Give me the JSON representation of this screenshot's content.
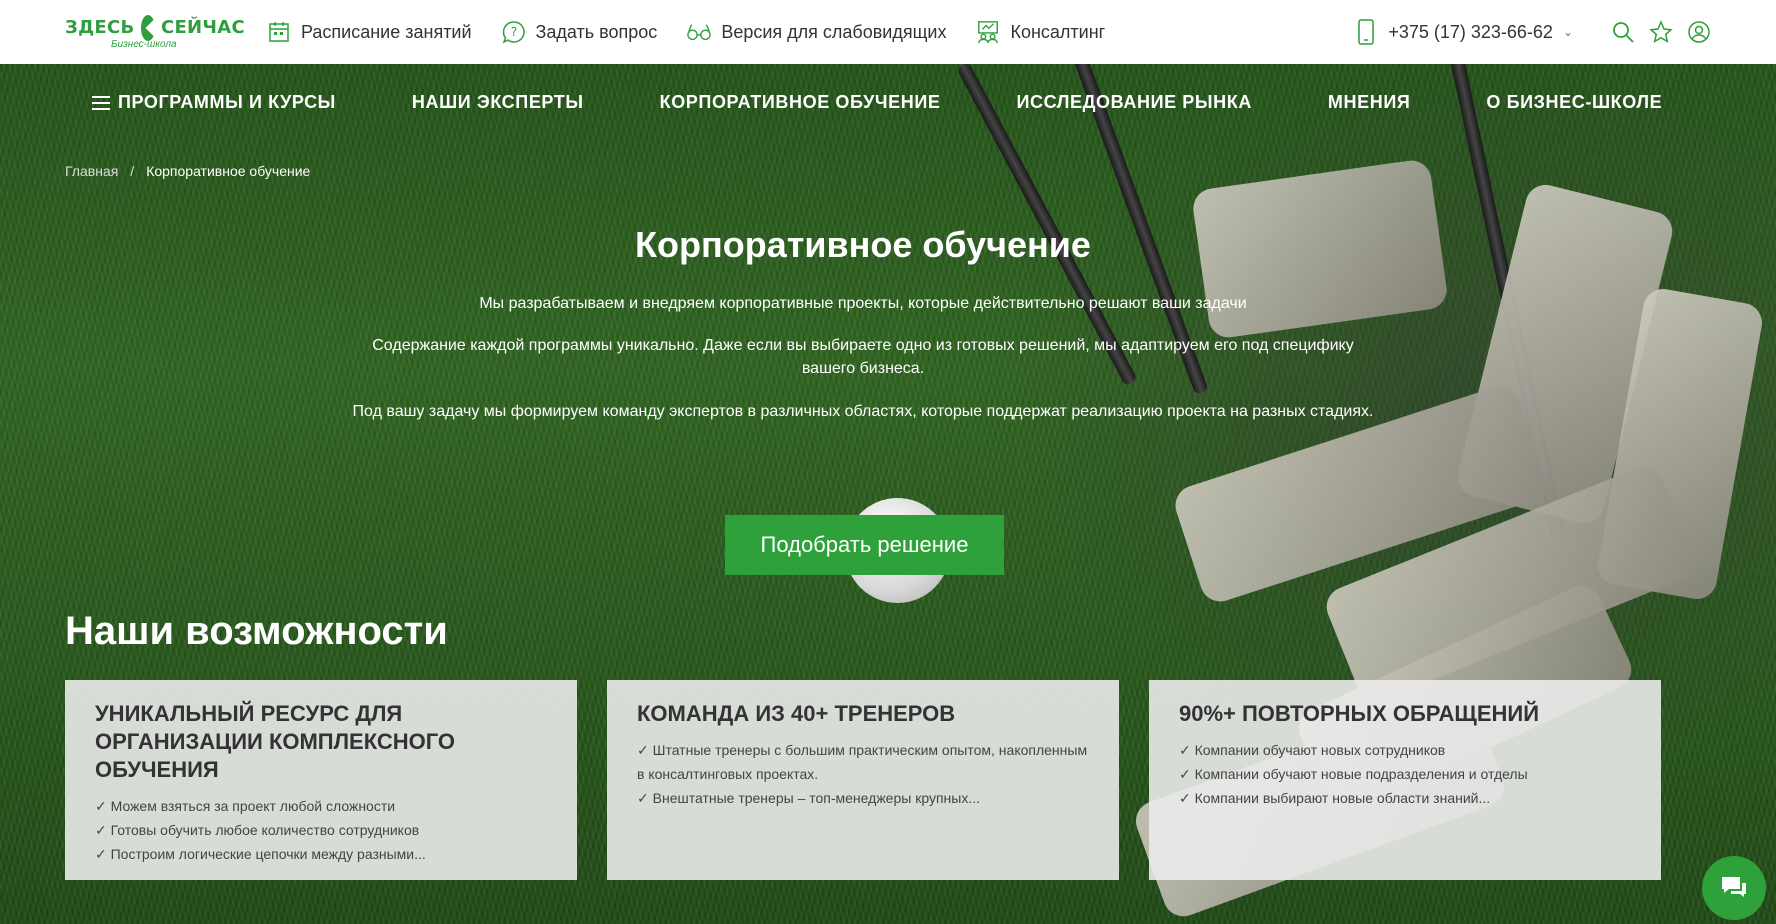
{
  "logo": {
    "name_left": "ЗДЕСЬ",
    "name_right": "СЕЙЧАС",
    "subtitle": "Бизнес-школа"
  },
  "top_links": [
    {
      "label": "Расписание занятий",
      "icon": "calendar-icon"
    },
    {
      "label": "Задать вопрос",
      "icon": "question-icon"
    },
    {
      "label": "Версия для слабовидящих",
      "icon": "glasses-icon"
    },
    {
      "label": "Консалтинг",
      "icon": "consulting-icon"
    }
  ],
  "phone": "+375 (17) 323-66-62",
  "main_nav": [
    "ПРОГРАММЫ И КУРСЫ",
    "НАШИ ЭКСПЕРТЫ",
    "КОРПОРАТИВНОЕ ОБУЧЕНИЕ",
    "ИССЛЕДОВАНИЕ РЫНКА",
    "МНЕНИЯ",
    "О БИЗНЕС-ШКОЛЕ"
  ],
  "breadcrumb": {
    "home": "Главная",
    "separator": "/",
    "current": "Корпоративное обучение"
  },
  "hero": {
    "title": "Корпоративное обучение",
    "p1": "Мы разрабатываем и внедряем корпоративные проекты, которые действительно решают ваши задачи",
    "p2": "Содержание каждой программы уникально. Даже если вы выбираете одно из готовых решений, мы адаптируем его под специфику вашего бизнеса.",
    "p3": "Под вашу задачу мы формируем команду экспертов в различных областях, которые поддержат реализацию проекта на разных стадиях.",
    "cta": "Подобрать решение"
  },
  "section_title": "Наши возможности",
  "cards": [
    {
      "title": "УНИКАЛЬНЫЙ РЕСУРС ДЛЯ ОРГАНИЗАЦИИ КОМПЛЕКСНОГО ОБУЧЕНИЯ",
      "items": [
        "✓ Можем взяться за проект любой сложности",
        "✓ Готовы обучить любое количество сотрудников",
        "✓ Построим логические цепочки между разными..."
      ]
    },
    {
      "title": "КОМАНДА ИЗ 40+ ТРЕНЕРОВ",
      "items": [
        "✓ Штатные тренеры с большим практическим опытом, накопленным в консалтинговых проектах.",
        "✓ Внештатные тренеры – топ-менеджеры крупных..."
      ]
    },
    {
      "title": "90%+ ПОВТОРНЫХ ОБРАЩЕНИЙ",
      "items": [
        "✓ Компании обучают новых сотрудников",
        "✓ Компании обучают новые подразделения и отделы",
        "✓ Компании выбирают новые области знаний..."
      ]
    }
  ],
  "colors": {
    "brand_green": "#2ea13a",
    "logo_green": "#2e9e3e"
  }
}
